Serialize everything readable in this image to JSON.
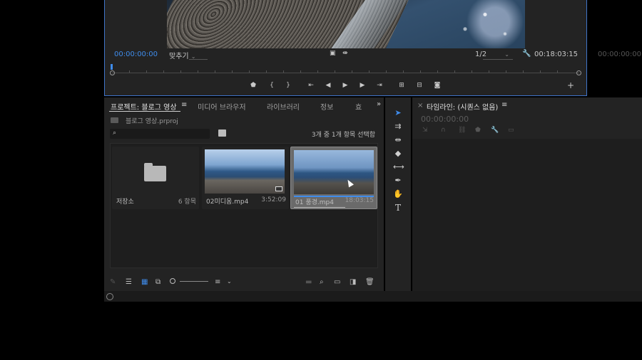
{
  "monitor": {
    "timecode_in": "00:00:00:00",
    "fit_label": "맞추기",
    "resolution": "1/2",
    "duration": "00:18:03:15"
  },
  "timeline_right_tc": "00:00:00:00",
  "project": {
    "tabs": [
      "프로젝트: 블로그 영상",
      "미디어 브라우저",
      "라이브러리",
      "정보",
      "효"
    ],
    "file_name": "블로그 영상.prproj",
    "selection_status": "3개 중 1개 항목 선택함",
    "search_placeholder": "",
    "items": [
      {
        "name": "저장소",
        "meta": "6 항목"
      },
      {
        "name": "02미디움.mp4",
        "meta": "3:52:09"
      },
      {
        "name": "01 풍경.mp4",
        "meta": "18:03:15"
      }
    ]
  },
  "timeline": {
    "title": "타임라인: (시퀀스 없음)",
    "timecode": "00:00:00:00"
  },
  "icons": {
    "selection": "arrow-select-icon",
    "track_select": "track-select-icon",
    "ripple": "ripple-edit-icon",
    "razor": "razor-icon",
    "slip": "slip-icon",
    "pen": "pen-icon",
    "hand": "hand-icon",
    "type": "type-icon"
  },
  "colors": {
    "accent": "#3f8ceb",
    "panel": "#232323",
    "panel_border_active": "#3f74c9"
  }
}
